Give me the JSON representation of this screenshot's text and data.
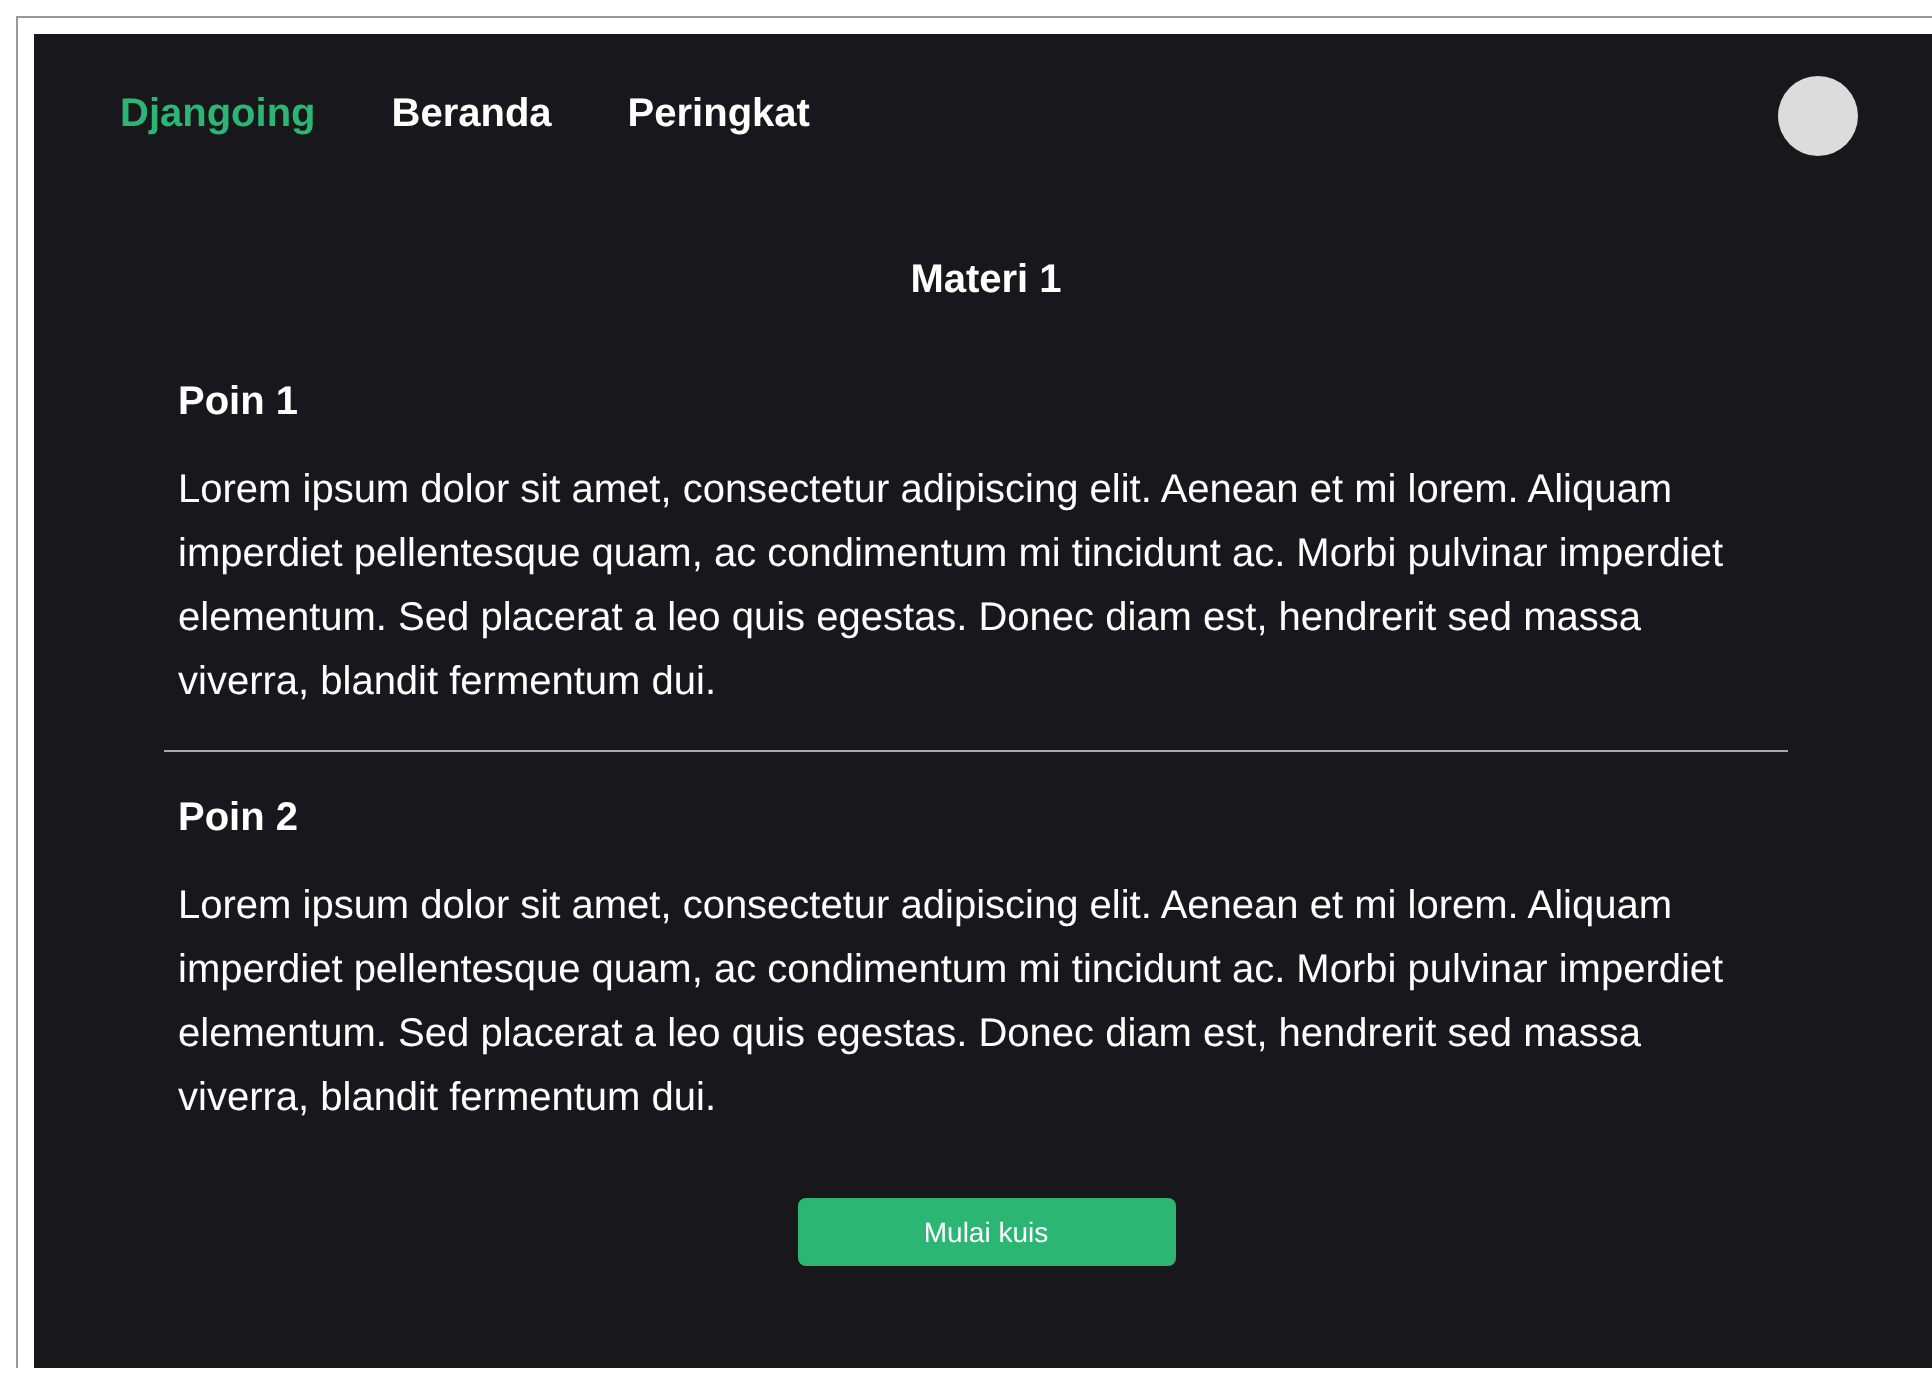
{
  "nav": {
    "brand": "Djangoing",
    "links": [
      {
        "label": "Beranda"
      },
      {
        "label": "Peringkat"
      }
    ]
  },
  "title": "Materi 1",
  "sections": [
    {
      "heading": "Poin 1",
      "text": "Lorem ipsum dolor sit amet, consectetur adipiscing elit. Aenean et mi lorem. Aliquam imperdiet pellentesque quam, ac condimentum mi tincidunt ac. Morbi pulvinar imperdiet elementum. Sed placerat a leo quis egestas. Donec diam est, hendrerit sed massa viverra, blandit fermentum dui."
    },
    {
      "heading": "Poin 2",
      "text": "Lorem ipsum dolor sit amet, consectetur adipiscing elit. Aenean et mi lorem. Aliquam imperdiet pellentesque quam, ac condimentum mi tincidunt ac. Morbi pulvinar imperdiet elementum. Sed placerat a leo quis egestas. Donec diam est, hendrerit sed massa viverra, blandit fermentum dui."
    }
  ],
  "button": "Mulai kuis"
}
